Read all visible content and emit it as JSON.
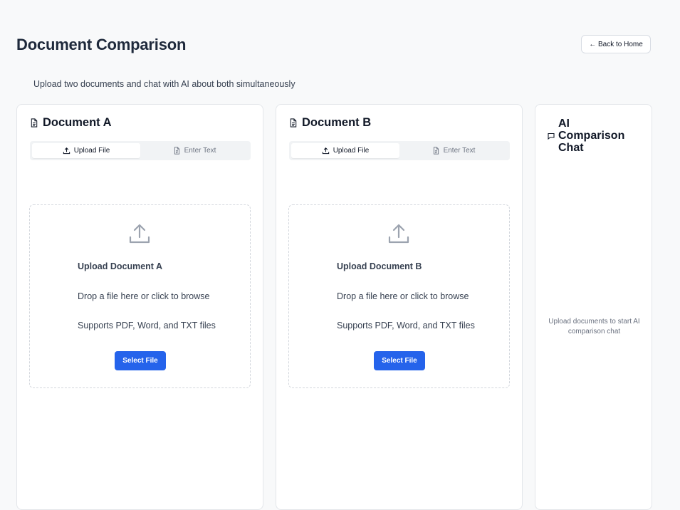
{
  "page": {
    "title": "Document Comparison",
    "back_label": "← Back to Home",
    "subtitle": "Upload two documents and chat with AI about both simultaneously"
  },
  "doc_a": {
    "title": "Document A",
    "tabs": [
      {
        "label": "Upload File",
        "active": true
      },
      {
        "label": "Enter Text",
        "active": false
      }
    ],
    "dropzone": {
      "title": "Upload Document A",
      "line1": "Drop a file here or click to browse",
      "line2": "Supports PDF, Word, and TXT files",
      "button": "Select File"
    }
  },
  "doc_b": {
    "title": "Document B",
    "tabs": [
      {
        "label": "Upload File",
        "active": true
      },
      {
        "label": "Enter Text",
        "active": false
      }
    ],
    "dropzone": {
      "title": "Upload Document B",
      "line1": "Drop a file here or click to browse",
      "line2": "Supports PDF, Word, and TXT files",
      "button": "Select File"
    }
  },
  "chat": {
    "title": "AI Comparison Chat",
    "empty_state": "Upload documents to start AI comparison chat"
  },
  "colors": {
    "accent": "#2563eb",
    "background": "#f8f9fa",
    "border": "#e3e6ea"
  },
  "icons": {
    "doc": "file-text-icon",
    "upload": "upload-icon",
    "chat": "message-square-icon"
  }
}
